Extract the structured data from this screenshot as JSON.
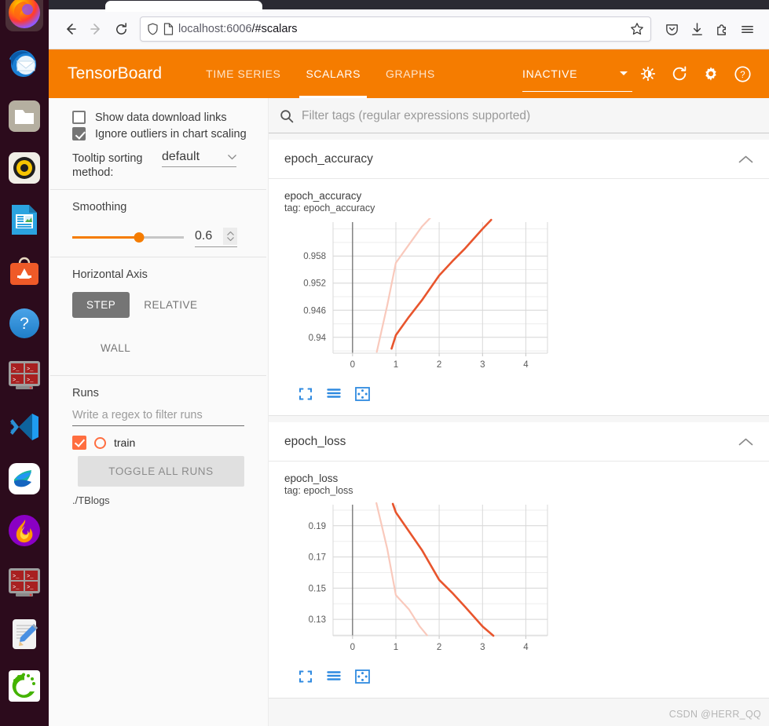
{
  "browser": {
    "url_host": "localhost:6006",
    "url_path": "/#scalars",
    "back_icon": "back-arrow-icon",
    "forward_icon": "forward-arrow-icon",
    "reload_icon": "reload-icon",
    "shield_icon": "shield-icon",
    "page_icon": "page-icon",
    "bookmark_icon": "star-icon",
    "pocket_icon": "pocket-icon",
    "downloads_icon": "download-icon",
    "extensions_icon": "extensions-icon",
    "menu_icon": "hamburger-menu-icon"
  },
  "header": {
    "logo": "TensorBoard",
    "tabs": [
      {
        "label": "TIME SERIES",
        "active": false
      },
      {
        "label": "SCALARS",
        "active": true
      },
      {
        "label": "GRAPHS",
        "active": false
      }
    ],
    "status": "INACTIVE",
    "brand_color": "#f57c00",
    "icons": {
      "dropdown": "chevron-down-icon",
      "theme": "brightness-contrast-icon",
      "reload": "refresh-icon",
      "settings": "gear-icon",
      "help": "help-circle-icon"
    }
  },
  "sidebar": {
    "show_download_links": {
      "label": "Show data download links",
      "checked": false
    },
    "ignore_outliers": {
      "label": "Ignore outliers in chart scaling",
      "checked": true
    },
    "tooltip_sorting": {
      "label": "Tooltip sorting method:",
      "value": "default"
    },
    "smoothing": {
      "label": "Smoothing",
      "value": "0.6",
      "fraction": 0.6
    },
    "horizontal_axis": {
      "label": "Horizontal Axis",
      "options": [
        "STEP",
        "RELATIVE",
        "WALL"
      ],
      "selected": "STEP"
    },
    "runs": {
      "label": "Runs",
      "filter_placeholder": "Write a regex to filter runs",
      "items": [
        {
          "name": "train",
          "checked": true,
          "color": "#ff6e40"
        }
      ],
      "toggle_all_label": "TOGGLE ALL RUNS",
      "logdir": "./TBlogs"
    }
  },
  "main": {
    "filter_placeholder": "Filter tags (regular expressions supported)",
    "search_icon": "search-icon",
    "cards": [
      {
        "title": "epoch_accuracy",
        "chart_name": "epoch_accuracy",
        "chart_tag": "tag: epoch_accuracy",
        "collapse_icon": "chevron-up-icon",
        "tools": [
          "expand-icon",
          "data-table-icon",
          "fit-domain-icon"
        ]
      },
      {
        "title": "epoch_loss",
        "chart_name": "epoch_loss",
        "chart_tag": "tag: epoch_loss",
        "collapse_icon": "chevron-up-icon",
        "tools": [
          "expand-icon",
          "data-table-icon",
          "fit-domain-icon"
        ]
      }
    ],
    "watermark": "CSDN @HERR_QQ"
  },
  "dock": {
    "items": [
      {
        "name": "firefox"
      },
      {
        "name": "thunderbird"
      },
      {
        "name": "files"
      },
      {
        "name": "rhythmbox"
      },
      {
        "name": "libreoffice-impress"
      },
      {
        "name": "ubuntu-software"
      },
      {
        "name": "help"
      },
      {
        "name": "terminator"
      },
      {
        "name": "vscode"
      },
      {
        "name": "docker"
      },
      {
        "name": "flameshot"
      },
      {
        "name": "terminator-2"
      },
      {
        "name": "text-editor"
      },
      {
        "name": "anaconda"
      }
    ]
  },
  "chart_data": [
    {
      "type": "line",
      "title": "epoch_accuracy",
      "tag": "epoch_accuracy",
      "xlabel": "",
      "ylabel": "",
      "xlim": [
        -0.45,
        4.5
      ],
      "ylim": [
        0.9365,
        0.9655
      ],
      "xticks": [
        0,
        1,
        2,
        3,
        4
      ],
      "yticks": [
        0.94,
        0.946,
        0.952,
        0.958
      ],
      "grid": true,
      "legend": false,
      "series": [
        {
          "name": "train (smoothed)",
          "color": "#e8552d",
          "opacity": 1,
          "x": [
            0.9,
            1.0,
            1.3,
            1.6,
            2.0,
            2.3,
            2.6,
            3.0,
            3.2
          ],
          "y": [
            0.9375,
            0.9405,
            0.9445,
            0.9482,
            0.9537,
            0.9568,
            0.9597,
            0.964,
            0.966
          ]
        },
        {
          "name": "train (raw)",
          "color": "#f9c9bc",
          "opacity": 1,
          "x": [
            0.56,
            0.8,
            1.0,
            1.3,
            1.6,
            1.85
          ],
          "y": [
            0.9368,
            0.947,
            0.9565,
            0.9605,
            0.9645,
            0.967
          ]
        }
      ]
    },
    {
      "type": "line",
      "title": "epoch_loss",
      "tag": "epoch_loss",
      "xlabel": "",
      "ylabel": "",
      "xlim": [
        -0.45,
        4.5
      ],
      "ylim": [
        0.1195,
        0.2035
      ],
      "xticks": [
        0,
        1,
        2,
        3,
        4
      ],
      "yticks": [
        0.13,
        0.15,
        0.17,
        0.19
      ],
      "grid": true,
      "legend": false,
      "series": [
        {
          "name": "train (smoothed)",
          "color": "#e8552d",
          "opacity": 1,
          "x": [
            0.93,
            1.0,
            1.3,
            1.6,
            2.0,
            2.3,
            2.6,
            3.0,
            3.25
          ],
          "y": [
            0.204,
            0.1985,
            0.1865,
            0.1745,
            0.1553,
            0.147,
            0.138,
            0.1255,
            0.1195
          ]
        },
        {
          "name": "train (raw)",
          "color": "#f9c9bc",
          "opacity": 1,
          "x": [
            0.55,
            0.8,
            1.0,
            1.3,
            1.55,
            1.72
          ],
          "y": [
            0.2045,
            0.1755,
            0.1455,
            0.1365,
            0.1255,
            0.1198
          ]
        }
      ]
    }
  ]
}
